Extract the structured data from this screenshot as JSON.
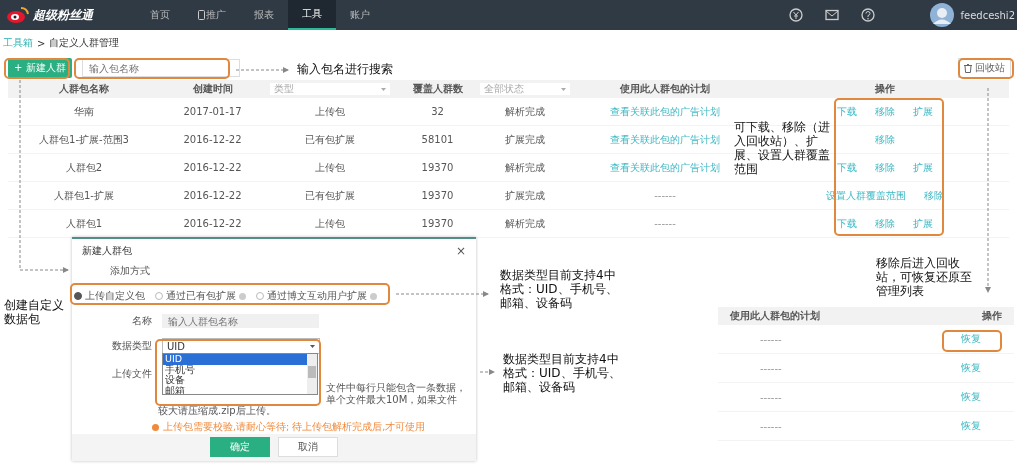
{
  "nav": {
    "logo": "超级粉丝通",
    "items": [
      {
        "label": "首页",
        "selected": false,
        "icon": false
      },
      {
        "label": "推广",
        "selected": false,
        "icon": true
      },
      {
        "label": "报表",
        "selected": false,
        "icon": false
      },
      {
        "label": "工具",
        "selected": true,
        "icon": false
      },
      {
        "label": "账户",
        "selected": false,
        "icon": false
      }
    ],
    "user": "feedceshi2"
  },
  "breadcrumb": {
    "parent": "工具箱",
    "separator": ">",
    "current": "自定义人群管理"
  },
  "toolbar": {
    "new_button": "+ 新建人群",
    "search": {
      "placeholder": "输入包名称"
    },
    "recycle_button": "回收站"
  },
  "table": {
    "columns": [
      {
        "kind": "text",
        "label": "人群包名称"
      },
      {
        "kind": "text",
        "label": "创建时间"
      },
      {
        "kind": "select",
        "label": "类型"
      },
      {
        "kind": "text",
        "label": "覆盖人群数"
      },
      {
        "kind": "select",
        "label": "全部状态"
      },
      {
        "kind": "text",
        "label": "使用此人群包的计划"
      },
      {
        "kind": "text",
        "label": "操作"
      }
    ],
    "rows": [
      {
        "name": "华南",
        "date": "2017-01-17",
        "type": "上传包",
        "count": "32",
        "status": "解析完成",
        "plan": {
          "kind": "link",
          "text": "查看关联此包的广告计划"
        },
        "actions": [
          "下载",
          "移除",
          "扩展"
        ]
      },
      {
        "name": "人群包1-扩展-范围3",
        "date": "2016-12-22",
        "type": "已有包扩展",
        "count": "58101",
        "status": "扩展完成",
        "plan": {
          "kind": "link",
          "text": "查看关联此包的广告计划"
        },
        "actions": [
          "移除"
        ]
      },
      {
        "name": "人群包2",
        "date": "2016-12-22",
        "type": "上传包",
        "count": "19370",
        "status": "解析完成",
        "plan": {
          "kind": "link",
          "text": "查看关联此包的广告计划"
        },
        "actions": [
          "下载",
          "移除",
          "扩展"
        ]
      },
      {
        "name": "人群包1-扩展",
        "date": "2016-12-22",
        "type": "已有包扩展",
        "count": "19370",
        "status": "扩展完成",
        "plan": {
          "kind": "text",
          "text": "------"
        },
        "actions": [
          "设置人群覆盖范围",
          "移除"
        ]
      },
      {
        "name": "人群包1",
        "date": "2016-12-22",
        "type": "上传包",
        "count": "19370",
        "status": "解析完成",
        "plan": {
          "kind": "text",
          "text": "------"
        },
        "actions": [
          "下载",
          "移除",
          "扩展"
        ]
      }
    ]
  },
  "dialog": {
    "title": "新建人群包",
    "close": "×",
    "method_label": "添加方式",
    "methods": [
      {
        "label": "上传自定义包",
        "selected": true,
        "info": false
      },
      {
        "label": "通过已有包扩展",
        "selected": false,
        "info": true
      },
      {
        "label": "通过博文互动用户扩展",
        "selected": false,
        "info": true
      }
    ],
    "name_label": "名称",
    "name_field": {
      "placeholder": "输入人群包名称"
    },
    "type_label": "数据类型",
    "type_select": {
      "value": "UID",
      "options": [
        {
          "label": "UID",
          "selected": true
        },
        {
          "label": "手机号",
          "selected": false
        },
        {
          "label": "设备",
          "selected": false
        },
        {
          "label": "邮箱",
          "selected": false
        }
      ]
    },
    "upload_label": "上传文件",
    "help_lines": [
      "文件中每行只能包含一条数据，",
      "单个文件最大10M，如果文件",
      "较大请压缩成.zip后上传。"
    ],
    "warning": "上传包需要校验,请耐心等待; 待上传包解析完成后,才可使用",
    "buttons": [
      {
        "label": "确定",
        "primary": true
      },
      {
        "label": "取消",
        "primary": false
      }
    ]
  },
  "annotations": [
    {
      "kind": "search",
      "text": "输入包名进行搜索"
    },
    {
      "kind": "create",
      "text": "创建自定义数据包"
    },
    {
      "kind": "actions",
      "text": "可下载、移除（进入回收站）、扩展、设置人群覆盖范围"
    },
    {
      "kind": "type1",
      "text": "数据类型目前支持4中格式：UID、手机号、邮箱、设备码"
    },
    {
      "kind": "type2",
      "text": "数据类型目前支持4中格式：UID、手机号、邮箱、设备码"
    },
    {
      "kind": "recycle",
      "text": "移除后进入回收站，可恢复还原至管理列表"
    }
  ],
  "recycle_table": {
    "columns": [
      "使用此人群包的计划",
      "操作"
    ],
    "rows": [
      {
        "plan": "------",
        "action": "恢复"
      },
      {
        "plan": "------",
        "action": "恢复"
      },
      {
        "plan": "------",
        "action": "恢复"
      },
      {
        "plan": "------",
        "action": "恢复"
      }
    ]
  }
}
